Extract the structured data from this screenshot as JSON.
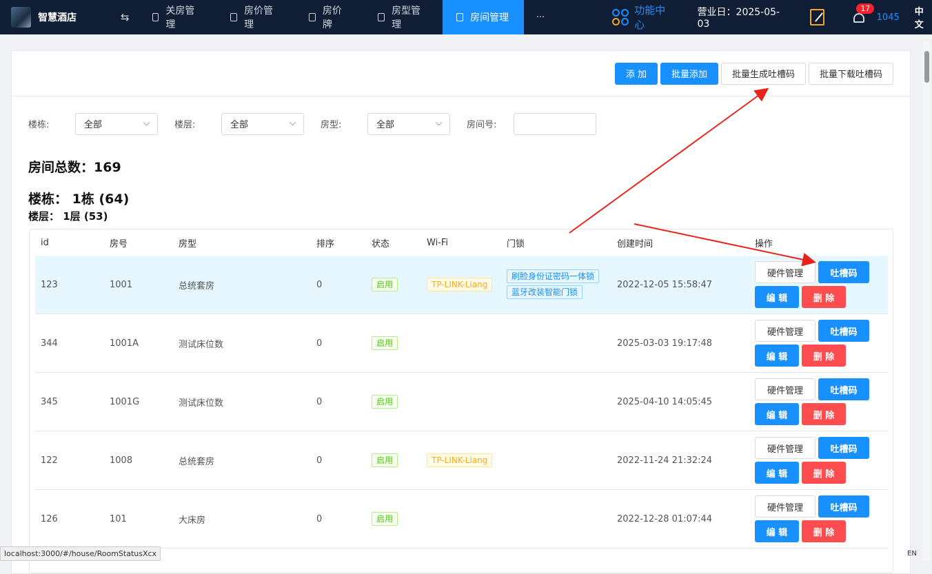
{
  "topbar": {
    "brand": "智慧酒店",
    "swap": "⇆",
    "nav": [
      {
        "label": "关房管理"
      },
      {
        "label": "房价管理"
      },
      {
        "label": "房价牌"
      },
      {
        "label": "房型管理"
      },
      {
        "label": "房间管理",
        "active": true
      }
    ],
    "more": "···",
    "func_center": "功能中心",
    "business_day": "营业日：2025-05-03",
    "badge": "17",
    "user": "1045",
    "lang": "中文"
  },
  "toolbar": {
    "add": "添 加",
    "batch_add": "批量添加",
    "batch_gen": "批量生成吐槽码",
    "batch_download": "批量下载吐槽码"
  },
  "filters": {
    "building_label": "楼栋:",
    "building_value": "全部",
    "floor_label": "楼层:",
    "floor_value": "全部",
    "type_label": "房型:",
    "type_value": "全部",
    "room_label": "房间号:"
  },
  "summary": {
    "total": "房间总数：169",
    "building": "楼栋：  1栋 (64)",
    "floor": "楼层：  1层 (53)"
  },
  "table": {
    "headers": [
      "id",
      "房号",
      "房型",
      "排序",
      "状态",
      "Wi-Fi",
      "门锁",
      "创建时间",
      "操作"
    ],
    "rows": [
      {
        "id": "123",
        "room": "1001",
        "type": "总统套房",
        "sort": "0",
        "status": "启用",
        "wifi": "TP-LINK-Liang",
        "locks": [
          "刷脸身份证密码一体锁",
          "蓝牙改装智能门锁"
        ],
        "created": "2022-12-05 15:58:47"
      },
      {
        "id": "344",
        "room": "1001A",
        "type": "测试床位数",
        "sort": "0",
        "status": "启用",
        "wifi": "",
        "locks": [],
        "created": "2025-03-03 19:17:48"
      },
      {
        "id": "345",
        "room": "1001G",
        "type": "测试床位数",
        "sort": "0",
        "status": "启用",
        "wifi": "",
        "locks": [],
        "created": "2025-04-10 14:05:45"
      },
      {
        "id": "122",
        "room": "1008",
        "type": "总统套房",
        "sort": "0",
        "status": "启用",
        "wifi": "TP-LINK-Liang",
        "locks": [],
        "created": "2022-11-24 21:32:24"
      },
      {
        "id": "126",
        "room": "101",
        "type": "大床房",
        "sort": "0",
        "status": "启用",
        "wifi": "",
        "locks": [],
        "created": "2022-12-28 01:07:44"
      }
    ],
    "ops": {
      "hardware": "硬件管理",
      "qrcode": "吐槽码",
      "edit": "编 辑",
      "delete": "删 除"
    }
  },
  "status_url": "localhost:3000/#/house/RoomStatusXcx",
  "ime": "EN"
}
